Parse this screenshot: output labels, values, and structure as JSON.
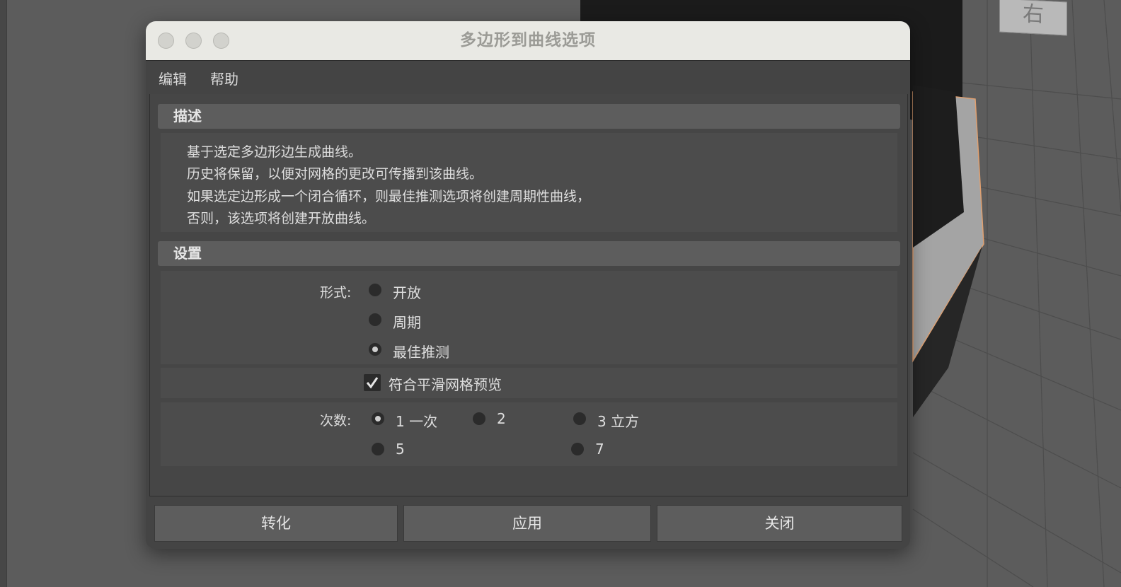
{
  "window": {
    "title": "多边形到曲线选项"
  },
  "menu": {
    "edit": "编辑",
    "help": "帮助"
  },
  "viewport": {
    "view_cube_label": "右"
  },
  "description": {
    "header": "描述",
    "lines": [
      "基于选定多边形边生成曲线。",
      "历史将保留，以便对网格的更改可传播到该曲线。",
      "如果选定边形成一个闭合循环，则最佳推测选项将创建周期性曲线，",
      "否则，该选项将创建开放曲线。"
    ]
  },
  "settings": {
    "header": "设置",
    "form": {
      "label": "形式:",
      "options": [
        "开放",
        "周期",
        "最佳推测"
      ],
      "selected": "最佳推测"
    },
    "smooth_preview": {
      "label": "符合平滑网格预览",
      "checked": true
    },
    "degree": {
      "label": "次数:",
      "options": [
        "1 一次",
        "2",
        "3 立方",
        "5",
        "7"
      ],
      "selected": "1 一次"
    }
  },
  "buttons": {
    "convert": "转化",
    "apply": "应用",
    "close": "关闭"
  },
  "colors": {
    "panel": "#444444",
    "section_header": "#5d5d5d",
    "titlebar": "#e9e9e4",
    "mesh_highlight": "#e0a070"
  }
}
